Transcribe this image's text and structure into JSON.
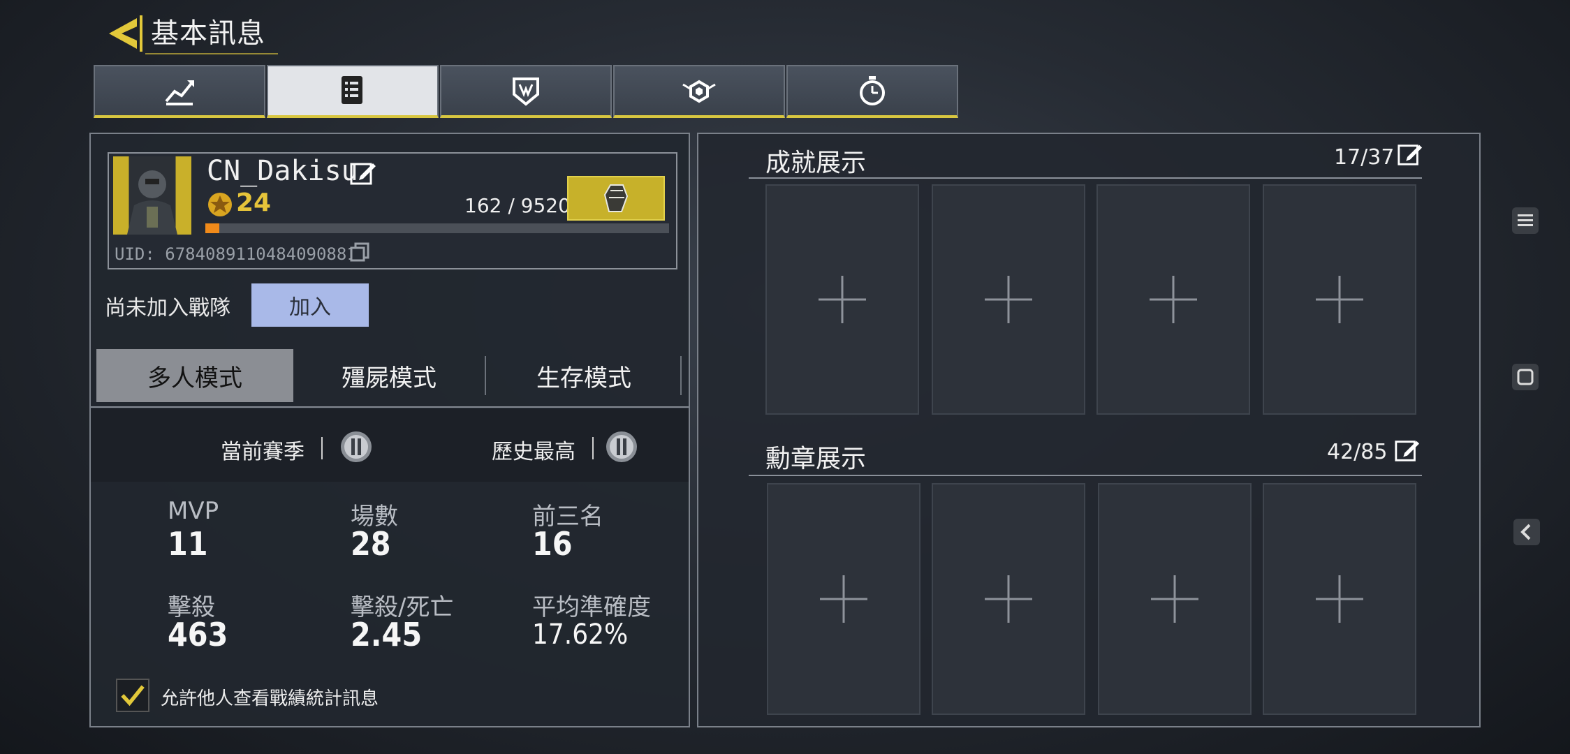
{
  "header": {
    "title": "基本訊息"
  },
  "tabs": [
    {
      "icon": "stats-chart-icon"
    },
    {
      "icon": "document-list-icon",
      "active": true
    },
    {
      "icon": "shield-icon"
    },
    {
      "icon": "winged-emblem-icon"
    },
    {
      "icon": "stopwatch-icon"
    }
  ],
  "profile": {
    "name": "CN_Dakisu",
    "level": "24",
    "xp_text": "162 / 9520",
    "xp_progress": 0.017,
    "uid": "UID: 6784089110484090881"
  },
  "team": {
    "status": "尚未加入戰隊",
    "join_label": "加入"
  },
  "modes": [
    "多人模式",
    "殭屍模式",
    "生存模式"
  ],
  "season": {
    "current_label": "當前賽季",
    "best_label": "歷史最高"
  },
  "stats": [
    {
      "label": "MVP",
      "value": "11"
    },
    {
      "label": "場數",
      "value": "28"
    },
    {
      "label": "前三名",
      "value": "16"
    },
    {
      "label": "擊殺",
      "value": "463"
    },
    {
      "label": "擊殺/死亡",
      "value": "2.45"
    },
    {
      "label": "平均準確度",
      "value": "17.62%"
    }
  ],
  "allow_text": "允許他人查看戰績統計訊息",
  "achievements": {
    "title": "成就展示",
    "count": "17/37"
  },
  "medals": {
    "title": "勳章展示",
    "count": "42/85"
  },
  "colors": {
    "accent_yellow": "#d8c640",
    "xp_orange": "#f08a1a",
    "join_blue": "#a9b9e8"
  }
}
